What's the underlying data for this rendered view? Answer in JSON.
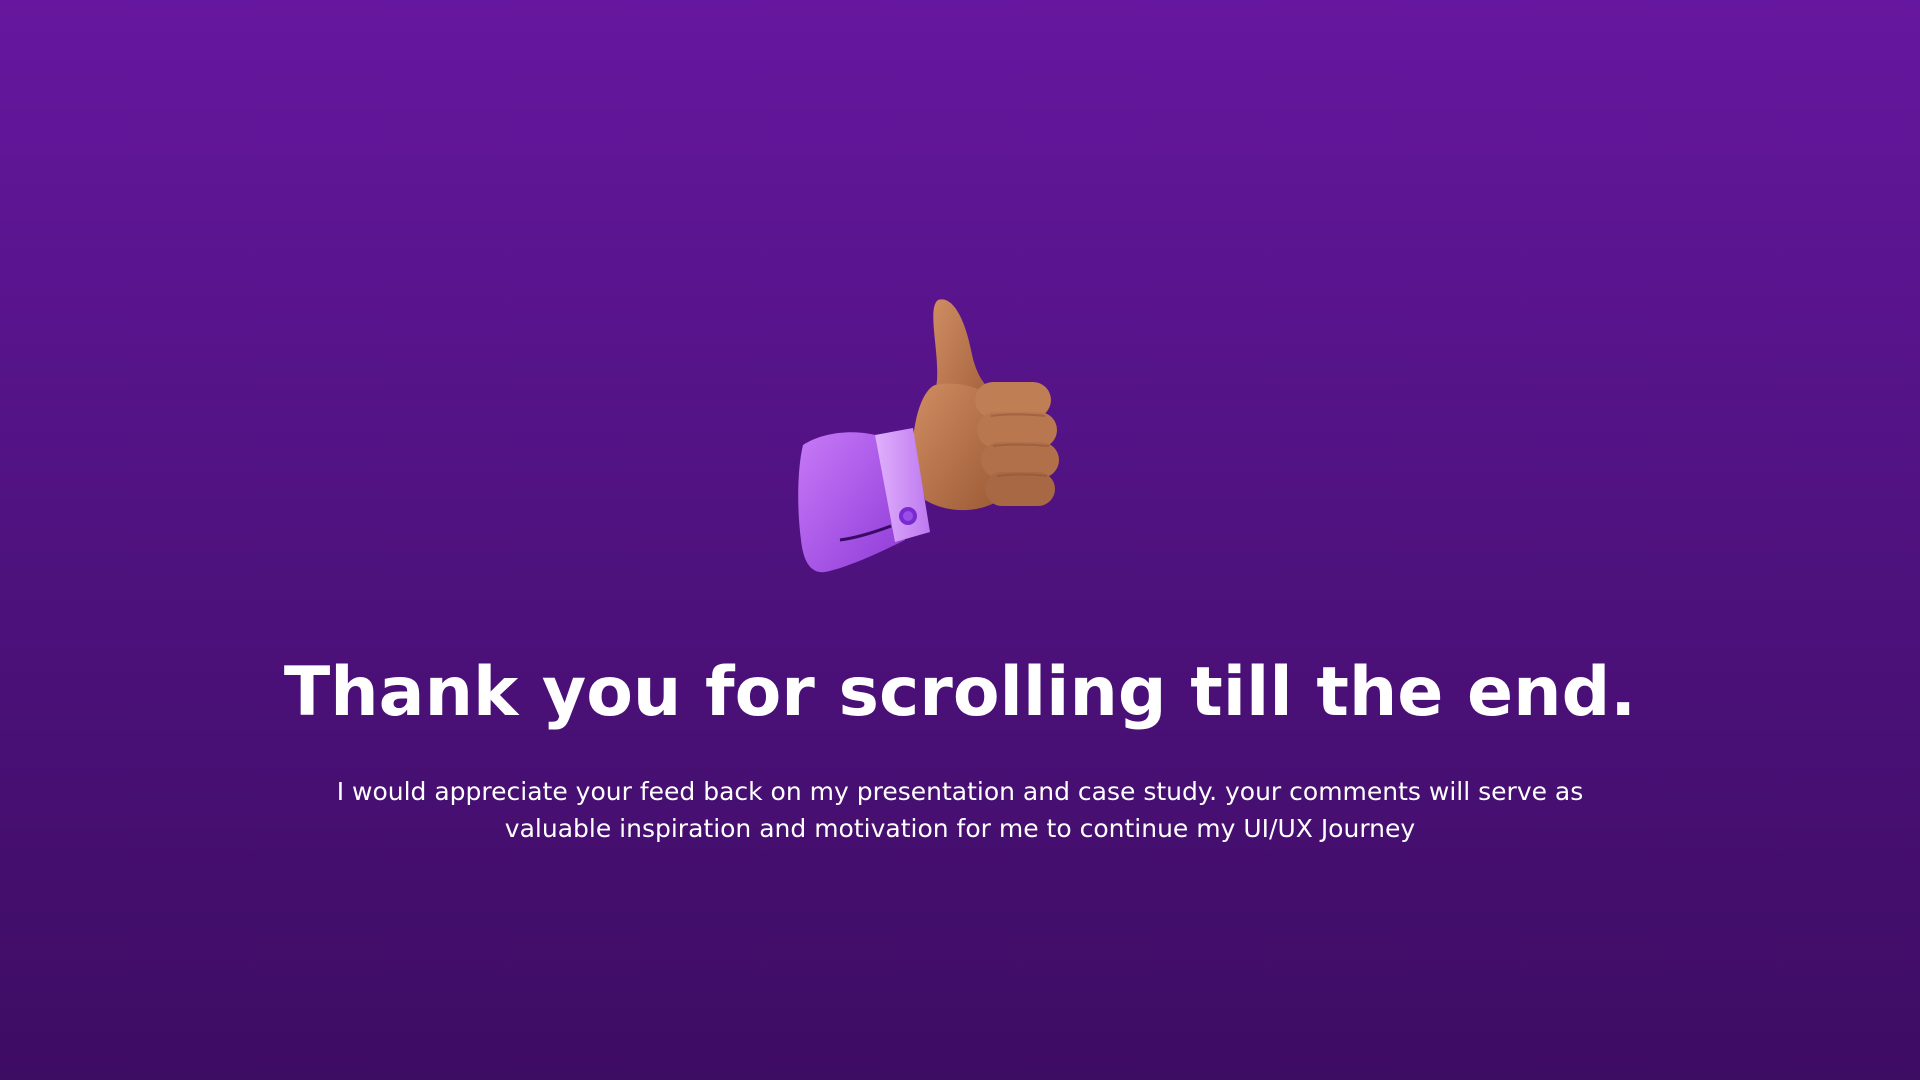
{
  "slide": {
    "illustration": {
      "icon": "thumbs-up-hand-icon",
      "colors": {
        "skin": "#b8744c",
        "skin_shadow": "#8c5232",
        "sleeve": "#b35df0",
        "cuff": "#d39af8",
        "button": "#7a2ad1"
      }
    },
    "title": "Thank you for scrolling till the end.",
    "body_line_1": "I would appreciate your feed back on my presentation and case study. your comments will serve as",
    "body_line_2": "valuable inspiration and motivation for me to continue my UI/UX Journey",
    "background": {
      "top": "#66179f",
      "bottom": "#3d0c63"
    }
  }
}
